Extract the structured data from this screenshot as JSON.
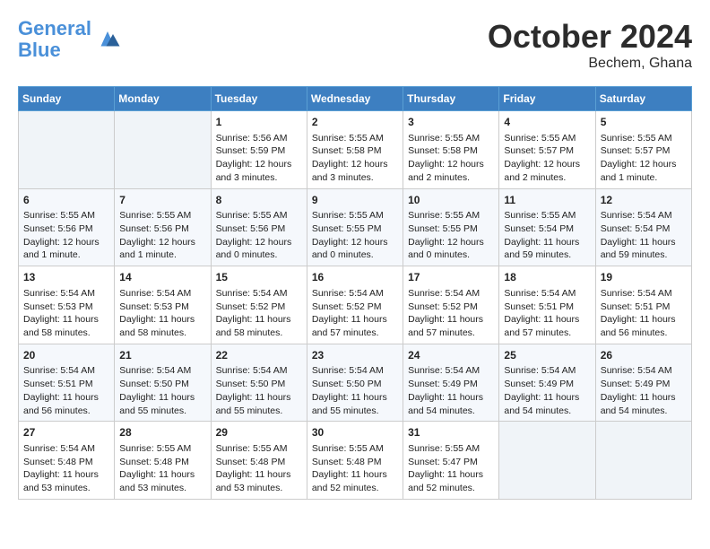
{
  "header": {
    "logo_line1": "General",
    "logo_line2": "Blue",
    "month": "October 2024",
    "location": "Bechem, Ghana"
  },
  "days_of_week": [
    "Sunday",
    "Monday",
    "Tuesday",
    "Wednesday",
    "Thursday",
    "Friday",
    "Saturday"
  ],
  "weeks": [
    [
      {
        "day": "",
        "info": ""
      },
      {
        "day": "",
        "info": ""
      },
      {
        "day": "1",
        "info": "Sunrise: 5:56 AM\nSunset: 5:59 PM\nDaylight: 12 hours\nand 3 minutes."
      },
      {
        "day": "2",
        "info": "Sunrise: 5:55 AM\nSunset: 5:58 PM\nDaylight: 12 hours\nand 3 minutes."
      },
      {
        "day": "3",
        "info": "Sunrise: 5:55 AM\nSunset: 5:58 PM\nDaylight: 12 hours\nand 2 minutes."
      },
      {
        "day": "4",
        "info": "Sunrise: 5:55 AM\nSunset: 5:57 PM\nDaylight: 12 hours\nand 2 minutes."
      },
      {
        "day": "5",
        "info": "Sunrise: 5:55 AM\nSunset: 5:57 PM\nDaylight: 12 hours\nand 1 minute."
      }
    ],
    [
      {
        "day": "6",
        "info": "Sunrise: 5:55 AM\nSunset: 5:56 PM\nDaylight: 12 hours\nand 1 minute."
      },
      {
        "day": "7",
        "info": "Sunrise: 5:55 AM\nSunset: 5:56 PM\nDaylight: 12 hours\nand 1 minute."
      },
      {
        "day": "8",
        "info": "Sunrise: 5:55 AM\nSunset: 5:56 PM\nDaylight: 12 hours\nand 0 minutes."
      },
      {
        "day": "9",
        "info": "Sunrise: 5:55 AM\nSunset: 5:55 PM\nDaylight: 12 hours\nand 0 minutes."
      },
      {
        "day": "10",
        "info": "Sunrise: 5:55 AM\nSunset: 5:55 PM\nDaylight: 12 hours\nand 0 minutes."
      },
      {
        "day": "11",
        "info": "Sunrise: 5:55 AM\nSunset: 5:54 PM\nDaylight: 11 hours\nand 59 minutes."
      },
      {
        "day": "12",
        "info": "Sunrise: 5:54 AM\nSunset: 5:54 PM\nDaylight: 11 hours\nand 59 minutes."
      }
    ],
    [
      {
        "day": "13",
        "info": "Sunrise: 5:54 AM\nSunset: 5:53 PM\nDaylight: 11 hours\nand 58 minutes."
      },
      {
        "day": "14",
        "info": "Sunrise: 5:54 AM\nSunset: 5:53 PM\nDaylight: 11 hours\nand 58 minutes."
      },
      {
        "day": "15",
        "info": "Sunrise: 5:54 AM\nSunset: 5:52 PM\nDaylight: 11 hours\nand 58 minutes."
      },
      {
        "day": "16",
        "info": "Sunrise: 5:54 AM\nSunset: 5:52 PM\nDaylight: 11 hours\nand 57 minutes."
      },
      {
        "day": "17",
        "info": "Sunrise: 5:54 AM\nSunset: 5:52 PM\nDaylight: 11 hours\nand 57 minutes."
      },
      {
        "day": "18",
        "info": "Sunrise: 5:54 AM\nSunset: 5:51 PM\nDaylight: 11 hours\nand 57 minutes."
      },
      {
        "day": "19",
        "info": "Sunrise: 5:54 AM\nSunset: 5:51 PM\nDaylight: 11 hours\nand 56 minutes."
      }
    ],
    [
      {
        "day": "20",
        "info": "Sunrise: 5:54 AM\nSunset: 5:51 PM\nDaylight: 11 hours\nand 56 minutes."
      },
      {
        "day": "21",
        "info": "Sunrise: 5:54 AM\nSunset: 5:50 PM\nDaylight: 11 hours\nand 55 minutes."
      },
      {
        "day": "22",
        "info": "Sunrise: 5:54 AM\nSunset: 5:50 PM\nDaylight: 11 hours\nand 55 minutes."
      },
      {
        "day": "23",
        "info": "Sunrise: 5:54 AM\nSunset: 5:50 PM\nDaylight: 11 hours\nand 55 minutes."
      },
      {
        "day": "24",
        "info": "Sunrise: 5:54 AM\nSunset: 5:49 PM\nDaylight: 11 hours\nand 54 minutes."
      },
      {
        "day": "25",
        "info": "Sunrise: 5:54 AM\nSunset: 5:49 PM\nDaylight: 11 hours\nand 54 minutes."
      },
      {
        "day": "26",
        "info": "Sunrise: 5:54 AM\nSunset: 5:49 PM\nDaylight: 11 hours\nand 54 minutes."
      }
    ],
    [
      {
        "day": "27",
        "info": "Sunrise: 5:54 AM\nSunset: 5:48 PM\nDaylight: 11 hours\nand 53 minutes."
      },
      {
        "day": "28",
        "info": "Sunrise: 5:55 AM\nSunset: 5:48 PM\nDaylight: 11 hours\nand 53 minutes."
      },
      {
        "day": "29",
        "info": "Sunrise: 5:55 AM\nSunset: 5:48 PM\nDaylight: 11 hours\nand 53 minutes."
      },
      {
        "day": "30",
        "info": "Sunrise: 5:55 AM\nSunset: 5:48 PM\nDaylight: 11 hours\nand 52 minutes."
      },
      {
        "day": "31",
        "info": "Sunrise: 5:55 AM\nSunset: 5:47 PM\nDaylight: 11 hours\nand 52 minutes."
      },
      {
        "day": "",
        "info": ""
      },
      {
        "day": "",
        "info": ""
      }
    ]
  ]
}
